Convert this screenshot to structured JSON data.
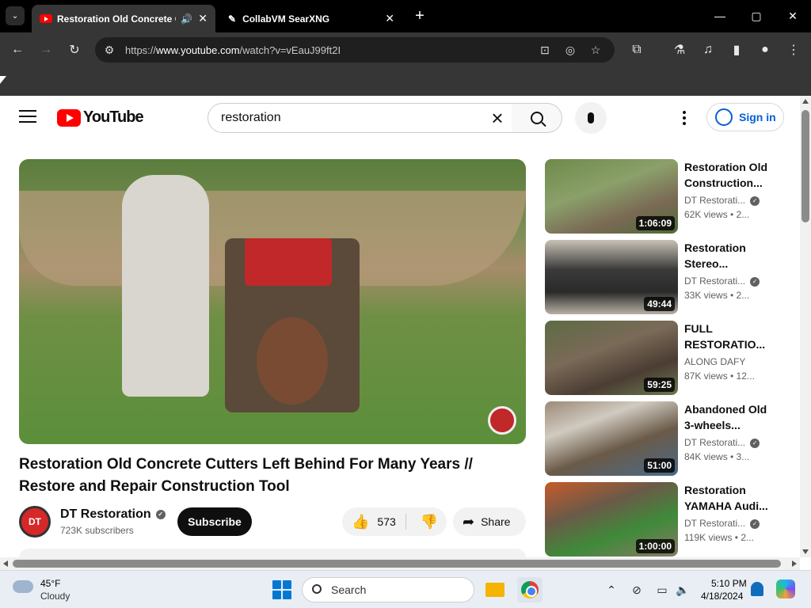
{
  "browser": {
    "tabs": [
      {
        "title": "Restoration Old Concrete Cutters Left Behind For Many Years // Restore and Repair Construction Tool - YouTube",
        "active": true,
        "audio": true
      },
      {
        "title": "CollabVM SearXNG",
        "active": false
      }
    ],
    "url_prefix": "https://",
    "url_host": "www.youtube.com",
    "url_path": "/watch?v=vEauJ99ft2I",
    "window_controls": {
      "minimize": "—",
      "maximize": "▢",
      "close": "✕"
    },
    "icons": {
      "back": "←",
      "forward": "→",
      "reload": "↻",
      "new_tab": "+",
      "tab_close": "✕",
      "tab_list": "⌄"
    }
  },
  "youtube": {
    "logo_text": "YouTube",
    "search_query": "restoration",
    "sign_in_label": "Sign in",
    "video": {
      "title": "Restoration Old Concrete Cutters Left Behind For Many Years // Restore and Repair Construction Tool",
      "channel_name": "DT Restoration",
      "channel_avatar_text": "DT",
      "subscribers": "723K subscribers",
      "subscribe_label": "Subscribe",
      "likes": "573",
      "share_label": "Share"
    },
    "recommendations": [
      {
        "title_line1": "Restoration Old",
        "title_line2": "Construction...",
        "channel": "DT Restorati...",
        "verified": true,
        "views": "62K views • 2...",
        "duration": "1:06:09"
      },
      {
        "title_line1": "Restoration",
        "title_line2": "Stereo...",
        "channel": "DT Restorati...",
        "verified": true,
        "views": "33K views • 2...",
        "duration": "49:44"
      },
      {
        "title_line1": "FULL",
        "title_line2": "RESTORATIO...",
        "channel": "ALONG DAFY",
        "verified": false,
        "views": "87K views • 12...",
        "duration": "59:25"
      },
      {
        "title_line1": "Abandoned Old",
        "title_line2": "3-wheels...",
        "channel": "DT Restorati...",
        "verified": true,
        "views": "84K views • 3...",
        "duration": "51:00"
      },
      {
        "title_line1": "Restoration",
        "title_line2": "YAMAHA Audi...",
        "channel": "DT Restorati...",
        "verified": true,
        "views": "119K views • 2...",
        "duration": "1:00:00"
      }
    ]
  },
  "taskbar": {
    "weather_temp": "45°F",
    "weather_desc": "Cloudy",
    "search_label": "Search",
    "time": "5:10 PM",
    "date": "4/18/2024"
  }
}
